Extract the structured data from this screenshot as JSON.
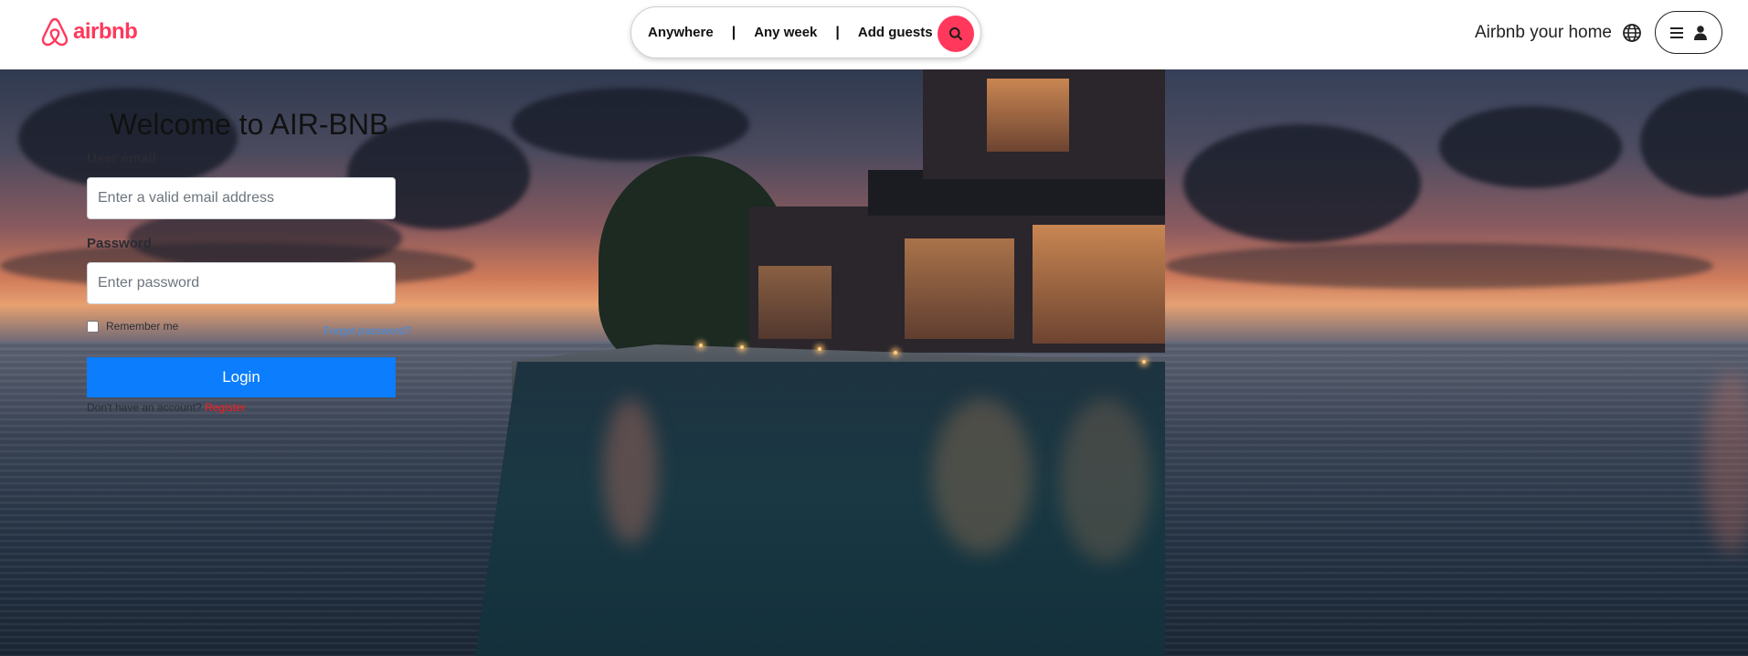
{
  "brand": {
    "name": "airbnb",
    "color": "#ff385c"
  },
  "search": {
    "where": "Anywhere",
    "when": "Any week",
    "who": "Add guests",
    "separator": "|",
    "button_icon": "search-icon"
  },
  "header_right": {
    "host_link": "Airbnb your home",
    "globe_icon": "globe-icon",
    "menu_icon": "hamburger-icon",
    "user_icon": "user-icon"
  },
  "login": {
    "title": "Welcome to AIR-BNB",
    "email_label": "User email",
    "email_placeholder": "Enter a valid email address",
    "password_label": "Password",
    "password_placeholder": "Enter password",
    "remember_label": "Remember me",
    "forgot_link": "Forgot password?",
    "login_button": "Login",
    "register_prompt": "Don't have an account?",
    "register_link": "Register",
    "button_color": "#0b7dfd"
  }
}
